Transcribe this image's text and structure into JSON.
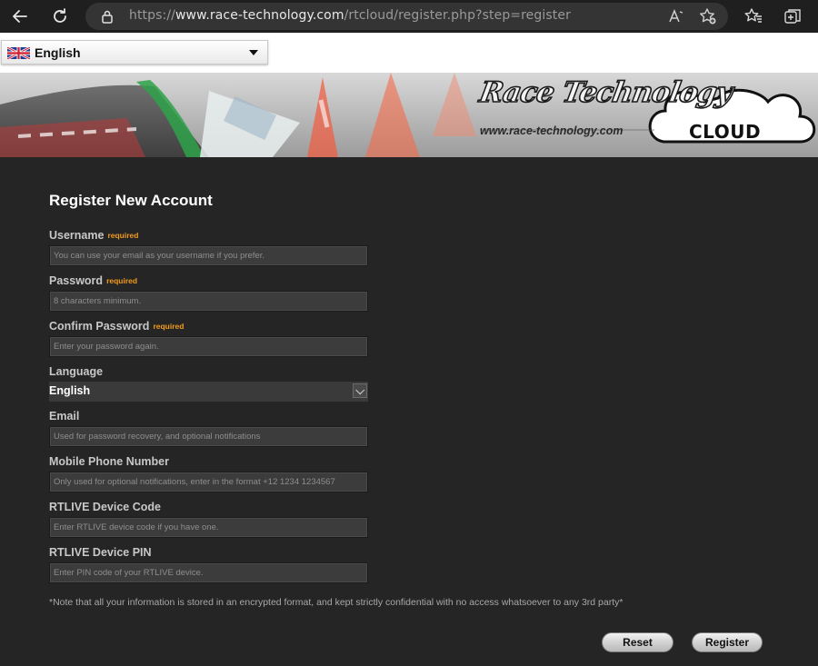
{
  "browser": {
    "url_scheme": "https://",
    "url_host": "www.race-technology.com",
    "url_path": "/rtcloud/register.php?step=register"
  },
  "page": {
    "language_switcher": "English"
  },
  "banner": {
    "logo_text": "Race Technology",
    "logo_url": "www.race-technology.com",
    "cloud_text": "CLOUD"
  },
  "form": {
    "title": "Register New Account",
    "required_tag": "required",
    "username": {
      "label": "Username",
      "placeholder": "You can use your email as your username if you prefer."
    },
    "password": {
      "label": "Password",
      "placeholder": "8 characters minimum."
    },
    "confirm_password": {
      "label": "Confirm Password",
      "placeholder": "Enter your password again."
    },
    "language": {
      "label": "Language",
      "value": "English"
    },
    "email": {
      "label": "Email",
      "placeholder": "Used for password recovery, and optional notifications"
    },
    "mobile": {
      "label": "Mobile Phone Number",
      "placeholder": "Only used for optional notifications, enter in the format +12 1234 1234567"
    },
    "device_code": {
      "label": "RTLIVE Device Code",
      "placeholder": "Enter RTLIVE device code if you have one."
    },
    "device_pin": {
      "label": "RTLIVE Device PIN",
      "placeholder": "Enter PIN code of your RTLIVE device."
    },
    "note": "*Note that all your information is stored in an encrypted format, and kept strictly confidential with no access whatsoever to any 3rd party*",
    "reset_label": "Reset",
    "register_label": "Register"
  },
  "colors": {
    "page_bg": "#252525",
    "required": "#f39b1a",
    "chrome_bg": "#1f1f1f"
  }
}
